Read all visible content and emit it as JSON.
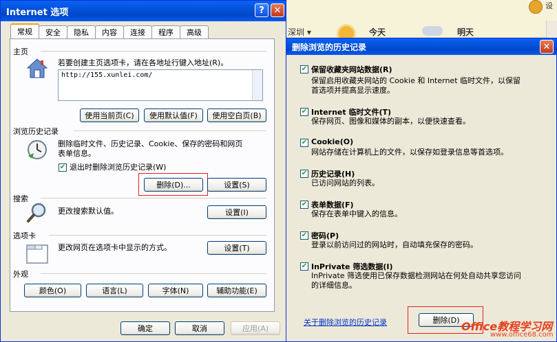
{
  "background": {
    "settings_text": "设",
    "weather_dropdown": "深圳 ▾",
    "today": "今天",
    "tomorrow": "明天"
  },
  "options_window": {
    "title": "Internet 选项",
    "help_glyph": "?",
    "close_glyph": "✕",
    "tabs": [
      "常规",
      "安全",
      "隐私",
      "内容",
      "连接",
      "程序",
      "高级"
    ],
    "home": {
      "heading": "主页",
      "description": "若要创建主页选项卡，请在各地址行键入地址(R)。",
      "address": "http://155.xunlei.com/",
      "buttons": [
        "使用当前页(C)",
        "使用默认值(F)",
        "使用空白页(B)"
      ]
    },
    "history": {
      "heading": "浏览历史记录",
      "description_line1": "删除临时文件、历史记录、Cookie、保存的密码和网页",
      "description_line2": "表单信息。",
      "checkbox_label": "退出时删除浏览历史记录(W)",
      "checkbox_checked": true,
      "delete_button": "删除(D)...",
      "settings_button": "设置(S)"
    },
    "search": {
      "heading": "搜索",
      "description": "更改搜索默认值。",
      "settings_button": "设置(I)"
    },
    "tabs_section": {
      "heading": "选项卡",
      "description": "更改网页在选项卡中显示的方式。",
      "settings_button": "设置(T)"
    },
    "appearance": {
      "heading": "外观",
      "buttons": [
        "颜色(O)",
        "语言(L)",
        "字体(N)",
        "辅助功能(E)"
      ]
    },
    "footer": {
      "ok": "确定",
      "cancel": "取消",
      "apply": "应用(A)"
    }
  },
  "delete_dialog": {
    "title": "删除浏览的历史记录",
    "close_glyph": "✕",
    "items": [
      {
        "title": "保留收藏夹网站数据(R)",
        "line1": "保留启用收藏夹网站的 Cookie 和 Internet 临时文件，以保留",
        "line2": "首选项并提高显示速度。",
        "checked": true
      },
      {
        "title": "Internet 临时文件(T)",
        "line1": "保存网页、图像和媒体的副本，以便快速查看。",
        "line2": "",
        "checked": true
      },
      {
        "title": "Cookie(O)",
        "line1": "网站存储在计算机上的文件，以保存如登录信息等首选项。",
        "line2": "",
        "checked": true
      },
      {
        "title": "历史记录(H)",
        "line1": "已访问网站的列表。",
        "line2": "",
        "checked": true
      },
      {
        "title": "表单数据(F)",
        "line1": "保存在表单中键入的信息。",
        "line2": "",
        "checked": true
      },
      {
        "title": "密码(P)",
        "line1": "登录以前访问过的网站时，自动填充保存的密码。",
        "line2": "",
        "checked": true
      },
      {
        "title": "InPrivate 筛选数据(I)",
        "line1": "InPrivate 筛选使用已保存数据检测网站在何处自动共享您访问",
        "line2": "的详细信息。",
        "checked": true
      }
    ],
    "link": "关于删除浏览的历史记录",
    "delete_button": "删除(D)"
  },
  "watermark": {
    "text": "Office教程学习网",
    "url": "www.office68.com"
  }
}
